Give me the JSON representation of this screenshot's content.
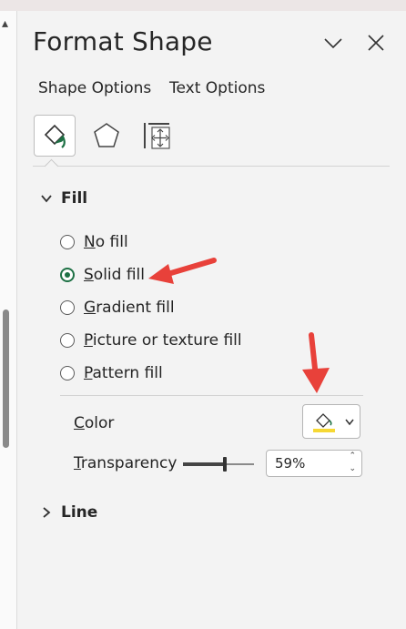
{
  "panel": {
    "title": "Format Shape",
    "header_icons": [
      "chevron-down-icon",
      "close-icon"
    ],
    "tabs": [
      {
        "label": "Shape Options",
        "selected": true
      },
      {
        "label": "Text Options",
        "selected": false
      }
    ],
    "icon_tabs": [
      "fill-and-line-icon",
      "effects-pentagon-icon",
      "size-and-properties-icon"
    ]
  },
  "fill": {
    "label": "Fill",
    "options": [
      "No fill",
      "Solid fill",
      "Gradient fill",
      "Picture or texture fill",
      "Pattern fill"
    ],
    "selected": "Solid fill",
    "color_label": "Color",
    "color_swatch": "#f6d834",
    "transparency_label": "Transparency",
    "transparency_value": "59%",
    "transparency_fraction": 0.59
  },
  "line": {
    "label": "Line"
  },
  "colors": {
    "accent": "#1e7145",
    "annotation": "#e8413a"
  }
}
